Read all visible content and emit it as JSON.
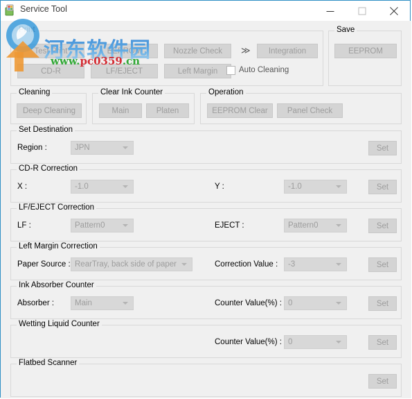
{
  "window": {
    "title": "Service Tool",
    "icon": "app-icon",
    "border_color": "#2e8fc4",
    "background": "#f0f0f0",
    "controls": {
      "minimize": "minimize-icon",
      "maximize": "maximize-icon",
      "close": "close-icon"
    }
  },
  "watermark": {
    "chinese": "河东软件园",
    "url_prefix": "www.",
    "url_mid": "pc0359",
    "url_suffix": ".cn",
    "color_blue": "#3f8fd8",
    "color_green": "#27a52b",
    "color_red": "#d4232a"
  },
  "print_group": {
    "legend": "Print",
    "buttons": [
      {
        "label": "Test Print"
      },
      {
        "label": "EEPROM"
      },
      {
        "label": "Nozzle Check"
      },
      {
        "label": "CD-R"
      },
      {
        "label": "LF/EJECT"
      },
      {
        "label": "Left Margin"
      }
    ],
    "arrows": "≫",
    "integration_label": "Integration",
    "auto_cleaning_label": "Auto Cleaning",
    "auto_cleaning_checked": false
  },
  "save_group": {
    "legend": "Save",
    "eeprom_label": "EEPROM"
  },
  "cleaning_group": {
    "legend": "Cleaning",
    "deep_cleaning_label": "Deep Cleaning"
  },
  "clear_ink_counter_group": {
    "legend": "Clear Ink Counter",
    "main_label": "Main",
    "platen_label": "Platen"
  },
  "operation_group": {
    "legend": "Operation",
    "eeprom_clear_label": "EEPROM Clear",
    "panel_check_label": "Panel Check"
  },
  "set_destination": {
    "legend": "Set Destination",
    "region_label": "Region :",
    "region_value": "JPN",
    "set_label": "Set"
  },
  "cdr_correction": {
    "legend": "CD-R Correction",
    "x_label": "X :",
    "x_value": "-1.0",
    "y_label": "Y :",
    "y_value": "-1.0",
    "set_label": "Set"
  },
  "lf_eject_correction": {
    "legend": "LF/EJECT Correction",
    "lf_label": "LF :",
    "lf_value": "Pattern0",
    "eject_label": "EJECT :",
    "eject_value": "Pattern0",
    "set_label": "Set"
  },
  "left_margin_correction": {
    "legend": "Left Margin Correction",
    "paper_source_label": "Paper Source :",
    "paper_source_value": "RearTray, back side of paper",
    "correction_value_label": "Correction Value :",
    "correction_value": "-3",
    "set_label": "Set"
  },
  "ink_absorber_counter": {
    "legend": "Ink Absorber Counter",
    "absorber_label": "Absorber :",
    "absorber_value": "Main",
    "counter_value_label": "Counter Value(%) :",
    "counter_value": "0",
    "set_label": "Set"
  },
  "wetting_liquid_counter": {
    "legend": "Wetting Liquid Counter",
    "counter_value_label": "Counter Value(%) :",
    "counter_value": "0",
    "set_label": "Set"
  },
  "flatbed_scanner": {
    "legend": "Flatbed Scanner",
    "set_label": "Set"
  }
}
